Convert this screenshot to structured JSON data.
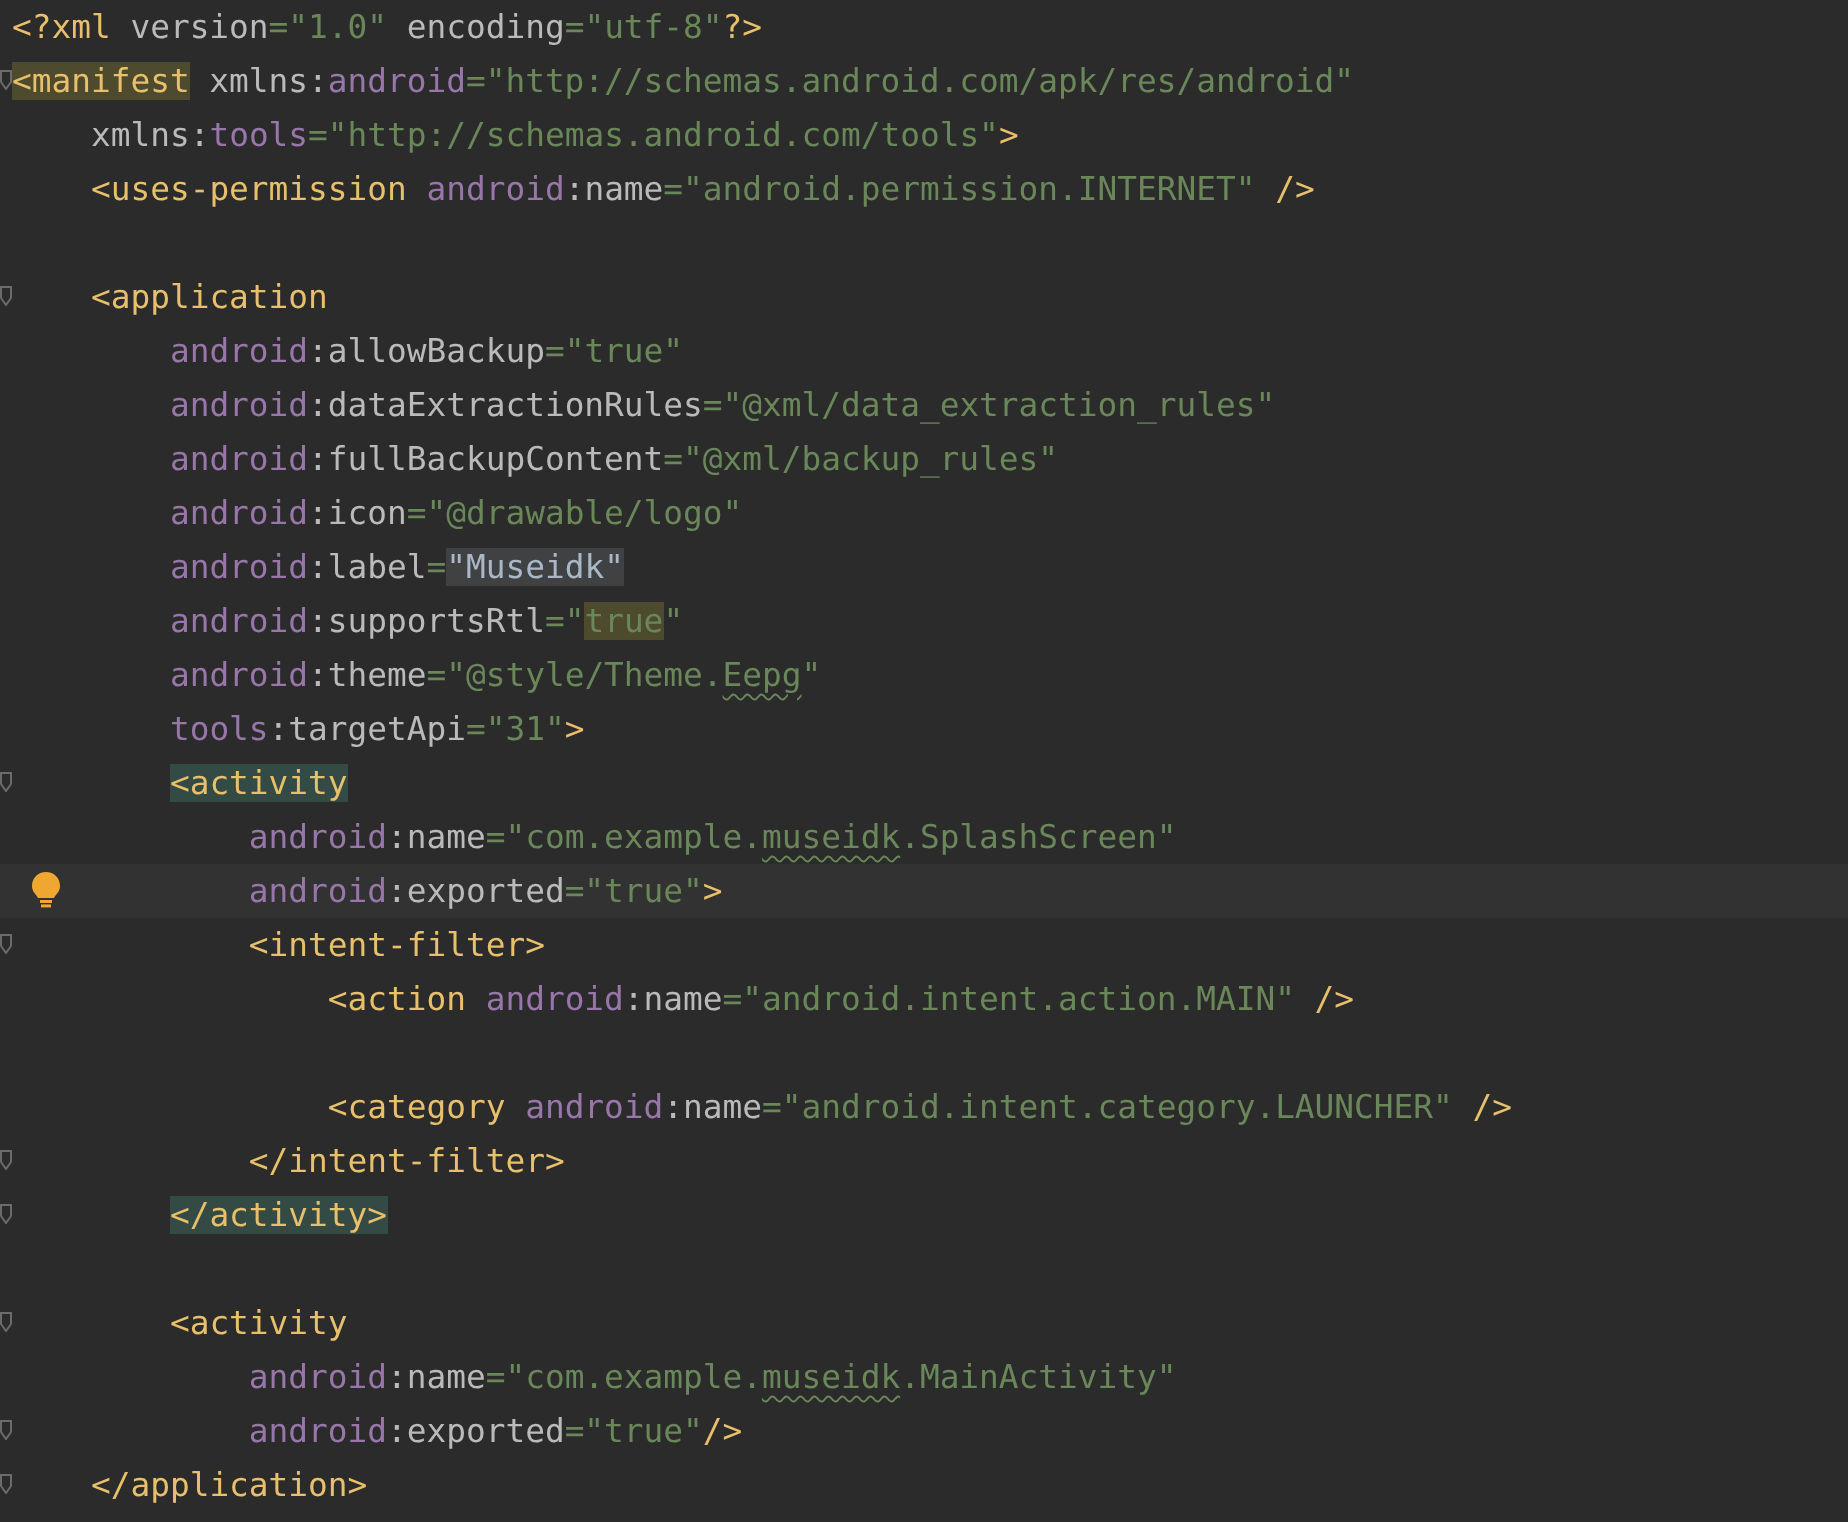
{
  "editor": {
    "lines": [
      {
        "tokens": [
          {
            "kind": "tag",
            "t": "<?xml"
          },
          {
            "kind": "attr",
            "t": " version"
          },
          {
            "kind": "str",
            "t": "=\"1.0\""
          },
          {
            "kind": "attr",
            "t": " encoding"
          },
          {
            "kind": "str",
            "t": "=\"utf-8\""
          },
          {
            "kind": "tag",
            "t": "?>"
          }
        ]
      },
      {
        "fold": true,
        "tokens": [
          {
            "kind": "tag",
            "t": "<manifest",
            "color": "#4d4a2e"
          },
          {
            "kind": "attr",
            "t": " xmlns:"
          },
          {
            "kind": "ns",
            "t": "android"
          },
          {
            "kind": "str",
            "t": "=\"http://schemas.android.com/apk/res/android\""
          }
        ]
      },
      {
        "tokens": [
          {
            "kind": "attr",
            "t": "    xmlns:"
          },
          {
            "kind": "ns",
            "t": "tools"
          },
          {
            "kind": "str",
            "t": "=\"http://schemas.android.com/tools\""
          },
          {
            "kind": "tag",
            "t": ">"
          }
        ]
      },
      {
        "space_after": true,
        "tokens": [
          {
            "kind": "tag",
            "t": "    <uses-permission "
          },
          {
            "kind": "ns",
            "t": "android"
          },
          {
            "kind": "attr",
            "t": ":name"
          },
          {
            "kind": "str",
            "t": "=\"android.permission.INTERNET\""
          },
          {
            "kind": "tag",
            "t": " />"
          }
        ]
      },
      {
        "fold": true,
        "tokens": [
          {
            "kind": "tag",
            "t": "    <application"
          }
        ]
      },
      {
        "tokens": [
          {
            "kind": "ns",
            "t": "        android"
          },
          {
            "kind": "attr",
            "t": ":allowBackup"
          },
          {
            "kind": "str",
            "t": "=\"true\""
          }
        ]
      },
      {
        "tokens": [
          {
            "kind": "ns",
            "t": "        android"
          },
          {
            "kind": "attr",
            "t": ":dataExtractionRules"
          },
          {
            "kind": "str",
            "t": "=\"@xml/data_extraction_rules\""
          }
        ]
      },
      {
        "tokens": [
          {
            "kind": "ns",
            "t": "        android"
          },
          {
            "kind": "attr",
            "t": ":fullBackupContent"
          },
          {
            "kind": "str",
            "t": "=\"@xml/backup_rules\""
          }
        ]
      },
      {
        "tokens": [
          {
            "kind": "ns",
            "t": "        android"
          },
          {
            "kind": "attr",
            "t": ":icon"
          },
          {
            "kind": "str",
            "t": "=\"@drawable/logo\""
          }
        ]
      },
      {
        "tokens": [
          {
            "kind": "ns",
            "t": "        android"
          },
          {
            "kind": "attr",
            "t": ":label"
          },
          {
            "kind": "str",
            "t": "="
          },
          {
            "kind": "plain",
            "t": "\"Museidk\"",
            "color": "#404142"
          }
        ]
      },
      {
        "tokens": [
          {
            "kind": "ns",
            "t": "        android"
          },
          {
            "kind": "attr",
            "t": ":supportsRtl"
          },
          {
            "kind": "str",
            "t": "=\""
          },
          {
            "kind": "str",
            "t": "true",
            "color": "#4d4a2e"
          },
          {
            "kind": "str",
            "t": "\""
          }
        ]
      },
      {
        "tokens": [
          {
            "kind": "ns",
            "t": "        android"
          },
          {
            "kind": "attr",
            "t": ":theme"
          },
          {
            "kind": "str",
            "t": "=\"@style/Theme."
          },
          {
            "kind": "str",
            "t": "Eepg",
            "typo": true
          },
          {
            "kind": "str",
            "t": "\""
          }
        ]
      },
      {
        "tokens": [
          {
            "kind": "ns",
            "t": "        tools"
          },
          {
            "kind": "attr",
            "t": ":targetApi"
          },
          {
            "kind": "str",
            "t": "=\"31\""
          },
          {
            "kind": "tag",
            "t": ">"
          }
        ]
      },
      {
        "fold": true,
        "tokens": [
          {
            "kind": "tag",
            "t": "        <activity",
            "color": "#344b45"
          }
        ]
      },
      {
        "tokens": [
          {
            "kind": "ns",
            "t": "            android"
          },
          {
            "kind": "attr",
            "t": ":name"
          },
          {
            "kind": "str",
            "t": "=\"com.example."
          },
          {
            "kind": "str",
            "t": "museidk",
            "typo": true
          },
          {
            "kind": "str",
            "t": ".SplashScreen\""
          }
        ]
      },
      {
        "current": true,
        "hint": true,
        "tokens": [
          {
            "kind": "ns",
            "t": "            android"
          },
          {
            "kind": "attr",
            "t": ":exported"
          },
          {
            "kind": "str",
            "t": "=\"true\""
          },
          {
            "kind": "tag",
            "t": ">"
          }
        ]
      },
      {
        "fold": true,
        "tokens": [
          {
            "kind": "tag",
            "t": "            <intent-filter>"
          }
        ]
      },
      {
        "space_after": true,
        "tokens": [
          {
            "kind": "tag",
            "t": "                <action "
          },
          {
            "kind": "ns",
            "t": "android"
          },
          {
            "kind": "attr",
            "t": ":name"
          },
          {
            "kind": "str",
            "t": "=\"android.intent.action.MAIN\""
          },
          {
            "kind": "tag",
            "t": " />"
          }
        ]
      },
      {
        "tokens": [
          {
            "kind": "tag",
            "t": "                <category "
          },
          {
            "kind": "ns",
            "t": "android"
          },
          {
            "kind": "attr",
            "t": ":name"
          },
          {
            "kind": "str",
            "t": "=\"android.intent.category.LAUNCHER\""
          },
          {
            "kind": "tag",
            "t": " />"
          }
        ]
      },
      {
        "fold": true,
        "tokens": [
          {
            "kind": "tag",
            "t": "            </intent-filter>"
          }
        ]
      },
      {
        "fold": true,
        "space_after": true,
        "tokens": [
          {
            "kind": "tag",
            "t": "        </activity>",
            "color": "#344b45"
          }
        ]
      },
      {
        "fold": true,
        "tokens": [
          {
            "kind": "tag",
            "t": "        <activity"
          }
        ]
      },
      {
        "tokens": [
          {
            "kind": "ns",
            "t": "            android"
          },
          {
            "kind": "attr",
            "t": ":name"
          },
          {
            "kind": "str",
            "t": "=\"com.example."
          },
          {
            "kind": "str",
            "t": "museidk",
            "typo": true
          },
          {
            "kind": "str",
            "t": ".MainActivity\""
          }
        ]
      },
      {
        "fold": true,
        "tokens": [
          {
            "kind": "ns",
            "t": "            android"
          },
          {
            "kind": "attr",
            "t": ":exported"
          },
          {
            "kind": "str",
            "t": "=\"true\""
          },
          {
            "kind": "tag",
            "t": "/>"
          }
        ]
      },
      {
        "fold": true,
        "tokens": [
          {
            "kind": "tag",
            "t": "    </application>"
          }
        ]
      }
    ]
  }
}
